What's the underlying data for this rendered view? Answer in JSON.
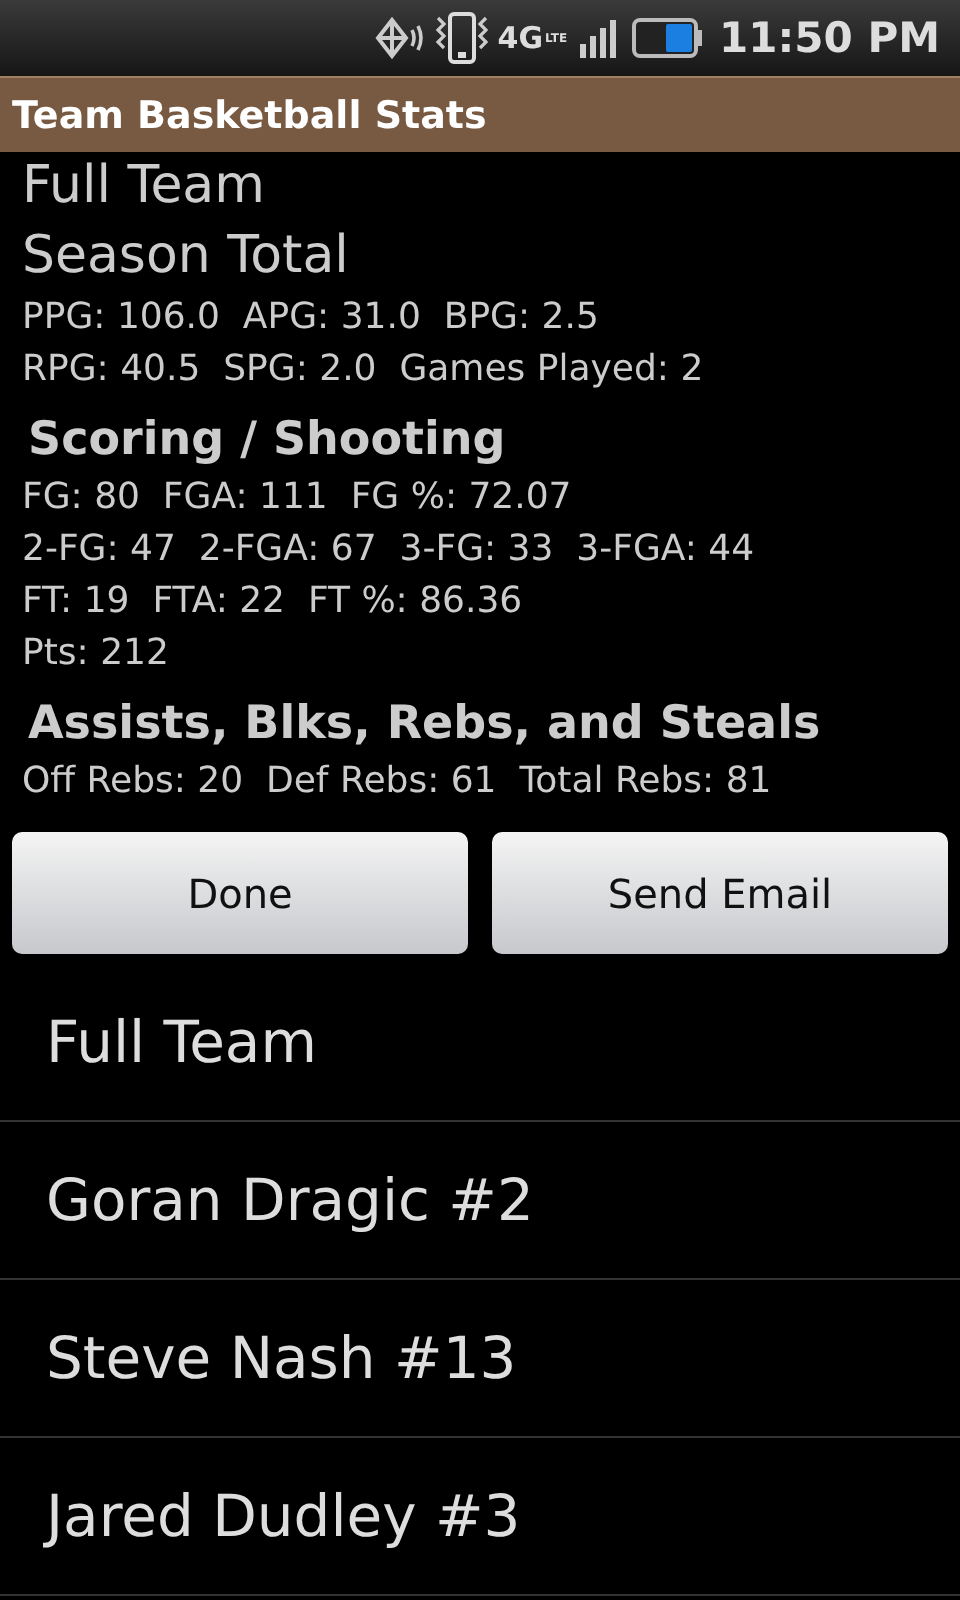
{
  "status_bar": {
    "network": "4G",
    "network_sub": "LTE",
    "time": "11:50 PM"
  },
  "title_bar": {
    "title": "Team Basketball Stats"
  },
  "stats": [
    {
      "kind": "title",
      "text": "Full Team"
    },
    {
      "kind": "subtitle",
      "text": "Season Total"
    },
    {
      "kind": "line",
      "text": "PPG: 106.0  APG: 31.0  BPG: 2.5"
    },
    {
      "kind": "line",
      "text": "RPG: 40.5  SPG: 2.0  Games Played: 2"
    },
    {
      "kind": "heading",
      "text": "Scoring / Shooting"
    },
    {
      "kind": "line",
      "text": "FG: 80  FGA: 111  FG %: 72.07"
    },
    {
      "kind": "line",
      "text": "2-FG: 47  2-FGA: 67  3-FG: 33  3-FGA: 44"
    },
    {
      "kind": "line",
      "text": "FT: 19  FTA: 22  FT %: 86.36"
    },
    {
      "kind": "line",
      "text": "Pts: 212"
    },
    {
      "kind": "heading",
      "text": "Assists, Blks, Rebs, and Steals"
    },
    {
      "kind": "line",
      "text": "Off Rebs: 20  Def Rebs: 61  Total Rebs: 81"
    }
  ],
  "buttons": [
    "Done",
    "Send Email"
  ],
  "players": [
    "Full Team",
    "Goran Dragic #2",
    "Steve Nash #13",
    "Jared Dudley #3"
  ]
}
